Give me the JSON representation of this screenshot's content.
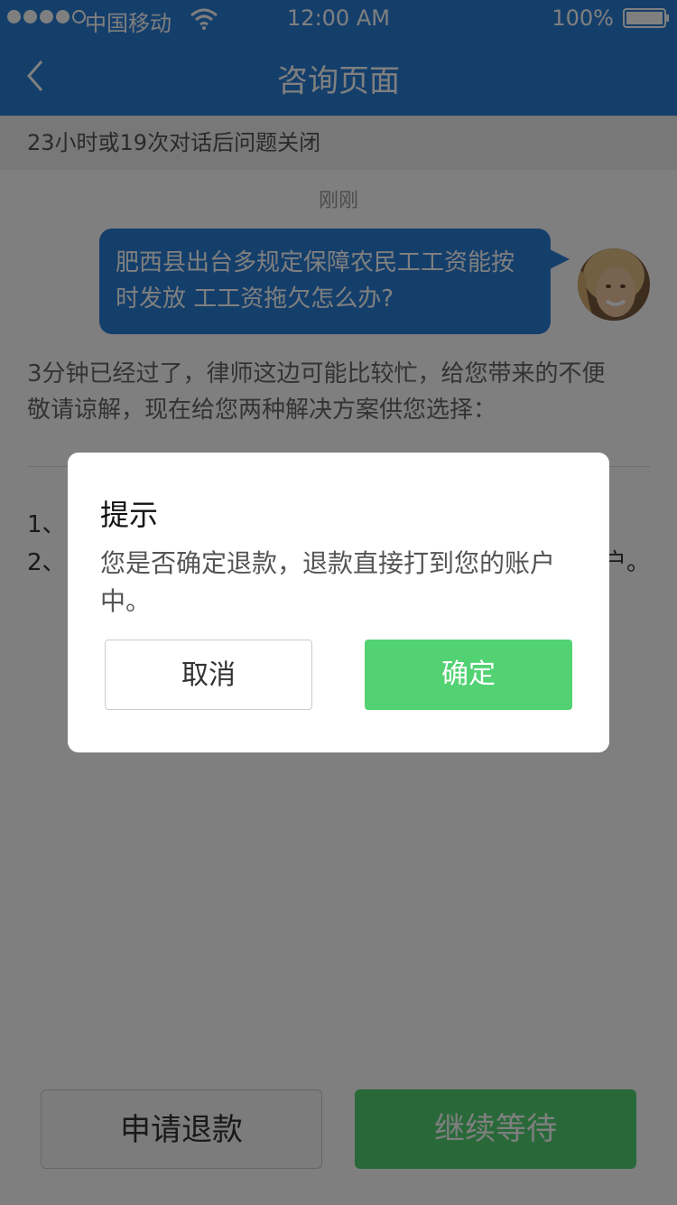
{
  "status_bar": {
    "carrier": "中国移动",
    "time": "12:00 AM",
    "battery": "100%"
  },
  "nav": {
    "title": "咨询页面",
    "back_icon": "chevron-left-icon"
  },
  "notice": "23小时或19次对话后问题关闭",
  "chat": {
    "timestamp": "刚刚",
    "user_message_line1": "肥西县出台多规定保障农民工工资能按",
    "user_message_line2": "时发放 工工资拖欠怎么办?",
    "system_message_line1": "3分钟已经过了，律师这边可能比较忙，给您带来的不便",
    "system_message_line2": "敬请谅解，现在给您两种解决方案供您选择：",
    "options": [
      {
        "prefix": "1、",
        "tail": ""
      },
      {
        "prefix": "2、",
        "tail": "户。"
      }
    ]
  },
  "buttons": {
    "refund": "申请退款",
    "continue_wait": "继续等待"
  },
  "dialog": {
    "title": "提示",
    "message": "您是否确定退款，退款直接打到您的账户中。",
    "cancel": "取消",
    "confirm": "确定"
  },
  "colors": {
    "primary_blue": "#2b7fd6",
    "confirm_green": "#52d273"
  }
}
